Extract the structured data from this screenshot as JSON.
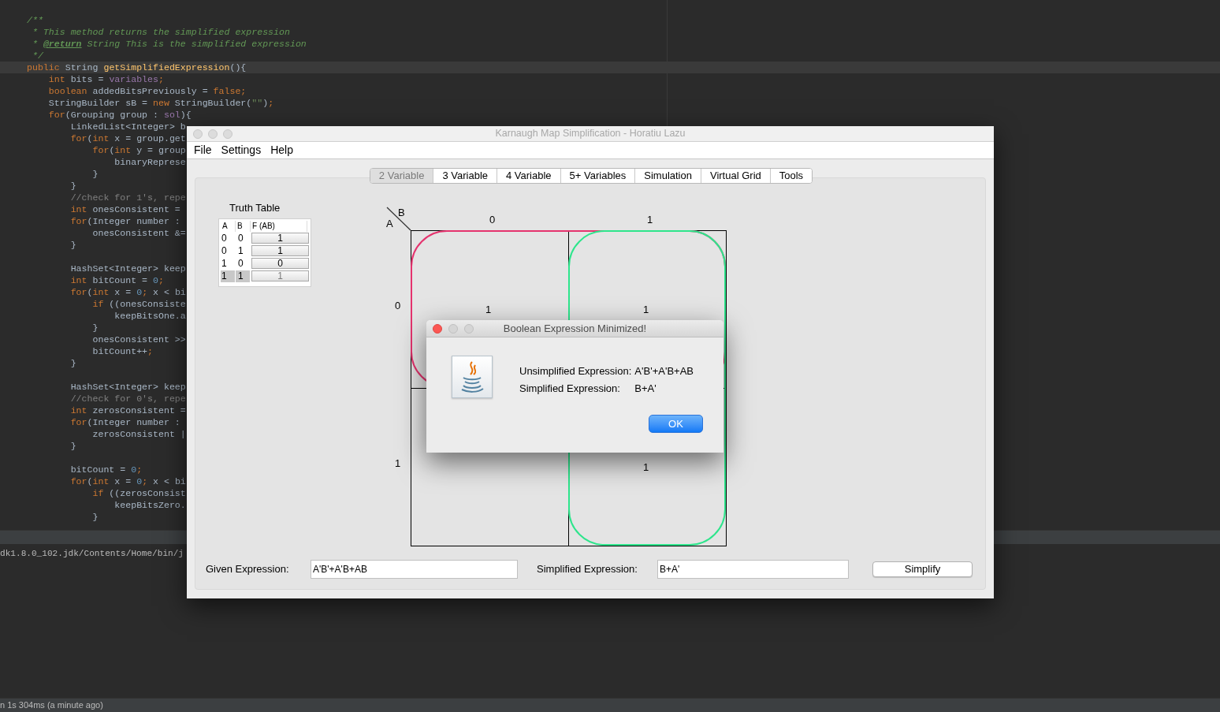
{
  "editor": {
    "lines": [
      {
        "kind": "code",
        "current": false,
        "tokens": [
          {
            "kind": "doc",
            "text": "/**"
          }
        ]
      },
      {
        "kind": "code",
        "current": false,
        "tokens": [
          {
            "kind": "doc",
            "text": " * This method returns the simplified expression"
          }
        ]
      },
      {
        "kind": "code",
        "current": false,
        "tokens": [
          {
            "kind": "doc",
            "text": " * "
          },
          {
            "kind": "doctag",
            "text": "@return"
          },
          {
            "kind": "doc",
            "text": " String This is the simplified expression"
          }
        ]
      },
      {
        "kind": "code",
        "current": false,
        "tokens": [
          {
            "kind": "doc",
            "text": " */"
          }
        ]
      },
      {
        "kind": "code",
        "current": true,
        "tokens": [
          {
            "kind": "kw",
            "text": "public"
          },
          {
            "kind": "plain",
            "text": " String "
          },
          {
            "kind": "method",
            "text": "getSimplifiedExpression"
          },
          {
            "kind": "plain",
            "text": "(){"
          }
        ]
      },
      {
        "kind": "code",
        "current": false,
        "tokens": [
          {
            "kind": "kw",
            "text": "    int"
          },
          {
            "kind": "plain",
            "text": " bits = "
          },
          {
            "kind": "field",
            "text": "variables"
          },
          {
            "kind": "kw",
            "text": ";"
          }
        ]
      },
      {
        "kind": "code",
        "current": false,
        "tokens": [
          {
            "kind": "kw",
            "text": "    boolean"
          },
          {
            "kind": "plain",
            "text": " addedBitsPreviously = "
          },
          {
            "kind": "kw",
            "text": "false;"
          }
        ]
      },
      {
        "kind": "code",
        "current": false,
        "tokens": [
          {
            "kind": "plain",
            "text": "    StringBuilder sB = "
          },
          {
            "kind": "kw",
            "text": "new"
          },
          {
            "kind": "plain",
            "text": " StringBuilder("
          },
          {
            "kind": "str",
            "text": "\"\""
          },
          {
            "kind": "plain",
            "text": ")"
          },
          {
            "kind": "kw",
            "text": ";"
          }
        ]
      },
      {
        "kind": "code",
        "current": false,
        "tokens": [
          {
            "kind": "kw",
            "text": "    for"
          },
          {
            "kind": "plain",
            "text": "(Grouping group : "
          },
          {
            "kind": "field",
            "text": "sol"
          },
          {
            "kind": "plain",
            "text": "){"
          }
        ]
      },
      {
        "kind": "code",
        "current": false,
        "tokens": [
          {
            "kind": "plain",
            "text": "        LinkedList<Integer> b"
          }
        ]
      },
      {
        "kind": "code",
        "current": false,
        "tokens": [
          {
            "kind": "kw",
            "text": "        for"
          },
          {
            "kind": "plain",
            "text": "("
          },
          {
            "kind": "kw",
            "text": "int"
          },
          {
            "kind": "plain",
            "text": " x = group.get"
          }
        ]
      },
      {
        "kind": "code",
        "current": false,
        "tokens": [
          {
            "kind": "kw",
            "text": "            for"
          },
          {
            "kind": "plain",
            "text": "("
          },
          {
            "kind": "kw",
            "text": "int"
          },
          {
            "kind": "plain",
            "text": " y = group"
          }
        ]
      },
      {
        "kind": "code",
        "current": false,
        "tokens": [
          {
            "kind": "plain",
            "text": "                binaryReprese"
          }
        ]
      },
      {
        "kind": "code",
        "current": false,
        "tokens": [
          {
            "kind": "plain",
            "text": "            }"
          }
        ]
      },
      {
        "kind": "code",
        "current": false,
        "tokens": [
          {
            "kind": "plain",
            "text": "        }"
          }
        ]
      },
      {
        "kind": "code",
        "current": false,
        "tokens": [
          {
            "kind": "comment",
            "text": "        //check for 1's, repe"
          }
        ]
      },
      {
        "kind": "code",
        "current": false,
        "tokens": [
          {
            "kind": "kw",
            "text": "        int"
          },
          {
            "kind": "plain",
            "text": " onesConsistent ="
          }
        ]
      },
      {
        "kind": "code",
        "current": false,
        "tokens": [
          {
            "kind": "kw",
            "text": "        for"
          },
          {
            "kind": "plain",
            "text": "(Integer number :"
          }
        ]
      },
      {
        "kind": "code",
        "current": false,
        "tokens": [
          {
            "kind": "plain",
            "text": "            onesConsistent &="
          }
        ]
      },
      {
        "kind": "code",
        "current": false,
        "tokens": [
          {
            "kind": "plain",
            "text": "        }"
          }
        ]
      },
      {
        "kind": "blank"
      },
      {
        "kind": "code",
        "current": false,
        "tokens": [
          {
            "kind": "plain",
            "text": "        HashSet<Integer> keep"
          }
        ]
      },
      {
        "kind": "code",
        "current": false,
        "tokens": [
          {
            "kind": "kw",
            "text": "        int"
          },
          {
            "kind": "plain",
            "text": " bitCount = "
          },
          {
            "kind": "num",
            "text": "0"
          },
          {
            "kind": "kw",
            "text": ";"
          }
        ]
      },
      {
        "kind": "code",
        "current": false,
        "tokens": [
          {
            "kind": "kw",
            "text": "        for"
          },
          {
            "kind": "plain",
            "text": "("
          },
          {
            "kind": "kw",
            "text": "int"
          },
          {
            "kind": "plain",
            "text": " x = "
          },
          {
            "kind": "num",
            "text": "0"
          },
          {
            "kind": "kw",
            "text": ";"
          },
          {
            "kind": "plain",
            "text": " x < bi"
          }
        ]
      },
      {
        "kind": "code",
        "current": false,
        "tokens": [
          {
            "kind": "kw",
            "text": "            if"
          },
          {
            "kind": "plain",
            "text": " ((onesConsiste"
          }
        ]
      },
      {
        "kind": "code",
        "current": false,
        "tokens": [
          {
            "kind": "plain",
            "text": "                keepBitsOne.a"
          }
        ]
      },
      {
        "kind": "code",
        "current": false,
        "tokens": [
          {
            "kind": "plain",
            "text": "            }"
          }
        ]
      },
      {
        "kind": "code",
        "current": false,
        "tokens": [
          {
            "kind": "plain",
            "text": "            onesConsistent >>"
          }
        ]
      },
      {
        "kind": "code",
        "current": false,
        "tokens": [
          {
            "kind": "plain",
            "text": "            bitCount++"
          },
          {
            "kind": "kw",
            "text": ";"
          }
        ]
      },
      {
        "kind": "code",
        "current": false,
        "tokens": [
          {
            "kind": "plain",
            "text": "        }"
          }
        ]
      },
      {
        "kind": "blank"
      },
      {
        "kind": "code",
        "current": false,
        "tokens": [
          {
            "kind": "plain",
            "text": "        HashSet<Integer> keep"
          }
        ]
      },
      {
        "kind": "code",
        "current": false,
        "tokens": [
          {
            "kind": "comment",
            "text": "        //check for 0's, repe"
          }
        ]
      },
      {
        "kind": "code",
        "current": false,
        "tokens": [
          {
            "kind": "kw",
            "text": "        int"
          },
          {
            "kind": "plain",
            "text": " zerosConsistent ="
          }
        ]
      },
      {
        "kind": "code",
        "current": false,
        "tokens": [
          {
            "kind": "kw",
            "text": "        for"
          },
          {
            "kind": "plain",
            "text": "(Integer number :"
          }
        ]
      },
      {
        "kind": "code",
        "current": false,
        "tokens": [
          {
            "kind": "plain",
            "text": "            zerosConsistent |"
          }
        ]
      },
      {
        "kind": "code",
        "current": false,
        "tokens": [
          {
            "kind": "plain",
            "text": "        }"
          }
        ]
      },
      {
        "kind": "blank"
      },
      {
        "kind": "code",
        "current": false,
        "tokens": [
          {
            "kind": "plain",
            "text": "        bitCount = "
          },
          {
            "kind": "num",
            "text": "0"
          },
          {
            "kind": "kw",
            "text": ";"
          }
        ]
      },
      {
        "kind": "code",
        "current": false,
        "tokens": [
          {
            "kind": "kw",
            "text": "        for"
          },
          {
            "kind": "plain",
            "text": "("
          },
          {
            "kind": "kw",
            "text": "int"
          },
          {
            "kind": "plain",
            "text": " x = "
          },
          {
            "kind": "num",
            "text": "0"
          },
          {
            "kind": "kw",
            "text": ";"
          },
          {
            "kind": "plain",
            "text": " x < bi"
          }
        ]
      },
      {
        "kind": "code",
        "current": false,
        "tokens": [
          {
            "kind": "kw",
            "text": "            if"
          },
          {
            "kind": "plain",
            "text": " ((zerosConsist"
          }
        ]
      },
      {
        "kind": "code",
        "current": false,
        "tokens": [
          {
            "kind": "plain",
            "text": "                keepBitsZero."
          }
        ]
      },
      {
        "kind": "code",
        "current": false,
        "tokens": [
          {
            "kind": "plain",
            "text": "            }"
          }
        ]
      }
    ]
  },
  "console": {
    "line": "dk1.8.0_102.jdk/Contents/Home/bin/j"
  },
  "status_bar": {
    "text": "n 1s 304ms (a minute ago)"
  },
  "window": {
    "title": "Karnaugh Map Simplification - Horatiu Lazu",
    "menu": [
      "File",
      "Settings",
      "Help"
    ],
    "tabs": [
      {
        "label": "2 Variable",
        "selected": true
      },
      {
        "label": "3 Variable",
        "selected": false
      },
      {
        "label": "4 Variable",
        "selected": false
      },
      {
        "label": "5+ Variables",
        "selected": false
      },
      {
        "label": "Simulation",
        "selected": false
      },
      {
        "label": "Virtual Grid",
        "selected": false
      },
      {
        "label": "Tools",
        "selected": false
      }
    ],
    "truth_table": {
      "title": "Truth Table",
      "columns": [
        "A",
        "B",
        "F (AB)"
      ],
      "rows": [
        {
          "a": "0",
          "b": "0",
          "f": "1",
          "selected": false
        },
        {
          "a": "0",
          "b": "1",
          "f": "1",
          "selected": false
        },
        {
          "a": "1",
          "b": "0",
          "f": "0",
          "selected": false
        },
        {
          "a": "1",
          "b": "1",
          "f": "1",
          "selected": true
        }
      ]
    },
    "kmap": {
      "row_var": "A",
      "col_var": "B",
      "col_headers": [
        "0",
        "1"
      ],
      "rows": [
        {
          "label": "0",
          "cells": [
            "1",
            "1"
          ]
        },
        {
          "label": "1",
          "cells": [
            null,
            "1"
          ]
        }
      ],
      "groups": [
        {
          "kind": "top-row",
          "color": "#e5336e"
        },
        {
          "kind": "right-column",
          "color": "#2ee58c"
        }
      ]
    },
    "given": {
      "label": "Given Expression:",
      "value": "A'B'+A'B+AB"
    },
    "simplified": {
      "label": "Simplified Expression:",
      "value": "B+A'"
    },
    "simplify_button": "Simplify"
  },
  "dialog": {
    "title": "Boolean Expression Minimized!",
    "lines": [
      {
        "label": "Unsimplified Expression:",
        "value": "A'B'+A'B+AB"
      },
      {
        "label": "Simplified Expression:",
        "value": "B+A'"
      }
    ],
    "button": "OK"
  }
}
